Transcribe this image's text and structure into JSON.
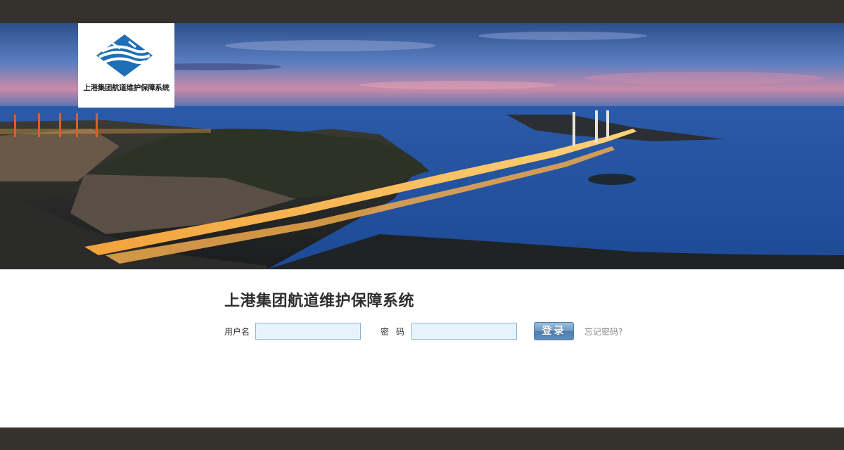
{
  "header": {
    "logo_text": "上港集团航道维护保障系统"
  },
  "login": {
    "title": "上港集团航道维护保障系统",
    "username_label": "用户名",
    "username_value": "",
    "password_label": "密码",
    "password_value": "",
    "submit_label": "登录",
    "forgot_label": "忘记密码?"
  },
  "colors": {
    "frame_bar": "#35322d",
    "input_bg": "#e6f3fc",
    "button_blue": "#5f8fbf",
    "logo_blue": "#1f6fb5"
  }
}
